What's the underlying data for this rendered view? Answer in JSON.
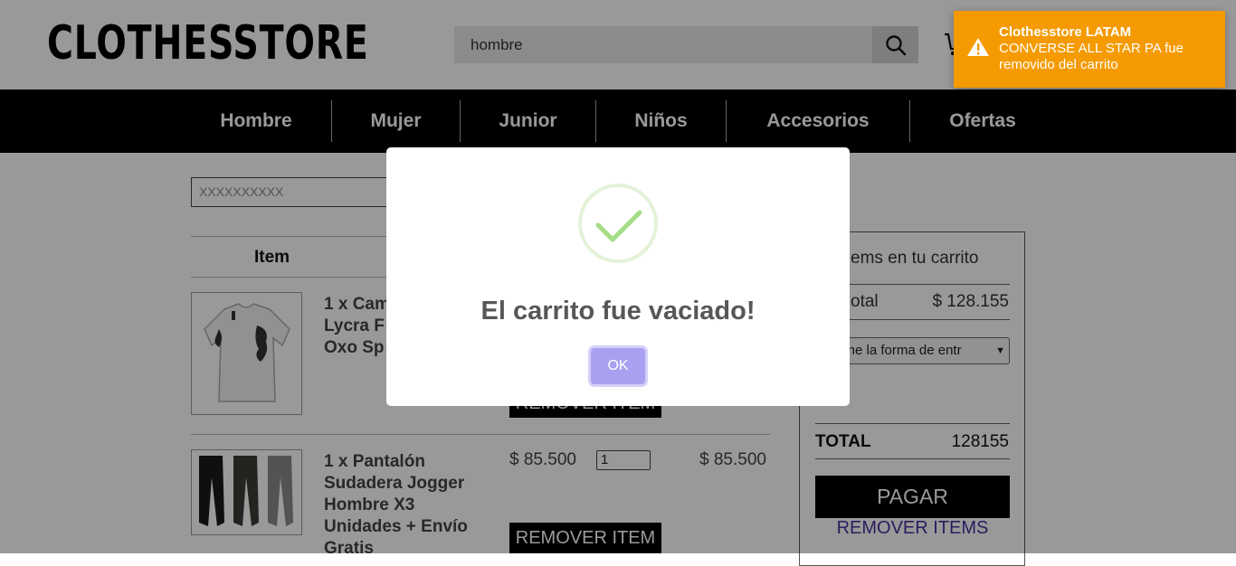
{
  "header": {
    "logo": "CLOTHESSTORE",
    "search_value": "hombre",
    "search_icon": "search-icon",
    "cart_icon": "cart-icon"
  },
  "nav": {
    "items": [
      "Hombre",
      "Mujer",
      "Junior",
      "Niños",
      "Accesorios",
      "Ofertas"
    ]
  },
  "cart": {
    "coupon_value": "XXXXXXXXXX",
    "column_item": "Item",
    "items": [
      {
        "name_lines": [
          "1 x Cam",
          "Lycra F",
          "Oxo Sp"
        ],
        "remove_label": "REMOVER ITEM"
      },
      {
        "name_lines": [
          "1 x Pantalón",
          "Sudadera Jogger",
          "Hombre X3",
          "Unidades + Envío",
          "Gratis"
        ],
        "unit_price": "$ 85.500",
        "quantity": "1",
        "total_price": "$ 85.500",
        "remove_label": "REMOVER ITEM"
      }
    ]
  },
  "summary": {
    "heading": "ems en tu carrito",
    "subtotal_label": "otal",
    "subtotal_value": "$ 128.155",
    "delivery_select": "ccione la forma de entr",
    "total_label": "TOTAL",
    "total_value": "128155",
    "pay_label": "PAGAR",
    "remove_all_label": "REMOVER ITEMS"
  },
  "modal": {
    "title": "El carrito fue vaciado!",
    "ok_label": "OK",
    "icon": "checkmark-icon"
  },
  "toast": {
    "title": "Clothesstore LATAM",
    "message": "CONVERSE ALL STAR PA fue removido del carrito",
    "icon": "warning-icon",
    "color": "#f59a00"
  },
  "colors": {
    "accent": "#a9a0f0",
    "success": "#a5dc86",
    "link": "#4a2f9e"
  }
}
